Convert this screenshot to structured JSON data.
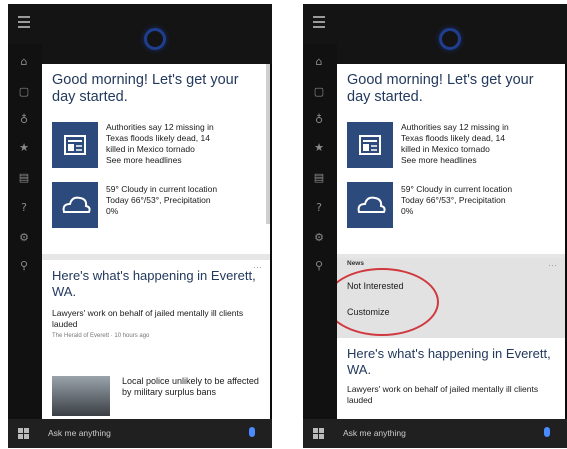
{
  "left": {
    "greeting": "Good morning! Let's get your day started.",
    "news": [
      "Authorities say 12 missing in",
      "Texas floods likely dead, 14",
      "killed in Mexico tornado"
    ],
    "see_more": "See more headlines",
    "weather": [
      "59° Cloudy in current location",
      "Today 66°/53°, Precipitation",
      "0%"
    ],
    "section_title": "Here's what's happening in Everett, WA.",
    "story1": "Lawyers' work on behalf of jailed mentally ill clients lauded",
    "story1_source": "The Herald of Everett · 10 hours ago",
    "story2": "Local police unlikely to be affected by military surplus bans",
    "more_dots": "···",
    "search_placeholder": "Ask me anything"
  },
  "right": {
    "greeting": "Good morning! Let's get your day started.",
    "news": [
      "Authorities say 12 missing in",
      "Texas floods likely dead, 14",
      "killed in Mexico tornado"
    ],
    "see_more": "See more headlines",
    "weather": [
      "59° Cloudy in current location",
      "Today 66°/53°, Precipitation",
      "0%"
    ],
    "menu_title": "News",
    "menu_items": [
      "Not Interested",
      "Customize"
    ],
    "section_title": "Here's what's happening in Everett, WA.",
    "story1": "Lawyers' work on behalf of jailed mentally ill clients lauded",
    "more_dots": "···",
    "search_placeholder": "Ask me anything"
  },
  "colors": {
    "accent_blue": "#2c4a7c",
    "highlight_red": "#d0393f",
    "mic_blue": "#4a8bff"
  }
}
